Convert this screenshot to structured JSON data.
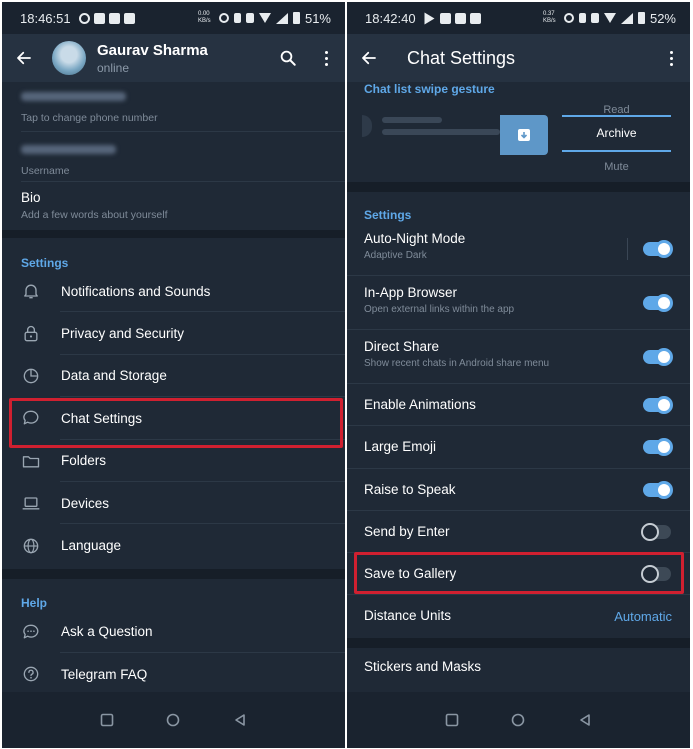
{
  "left": {
    "status": {
      "time": "18:46:51",
      "net": "0.00 KB/s",
      "battery": "51%"
    },
    "profile": {
      "name": "Gaurav Sharma",
      "status": "online"
    },
    "account": [
      {
        "hint": "Tap to change phone number"
      },
      {
        "hint": "Username"
      },
      {
        "label": "Bio",
        "hint": "Add a few words about yourself"
      }
    ],
    "settings_header": "Settings",
    "settings_items": [
      {
        "label": "Notifications and Sounds",
        "icon": "bell-icon"
      },
      {
        "label": "Privacy and Security",
        "icon": "lock-icon"
      },
      {
        "label": "Data and Storage",
        "icon": "pie-chart-icon"
      },
      {
        "label": "Chat Settings",
        "icon": "chat-bubble-icon"
      },
      {
        "label": "Folders",
        "icon": "folder-icon"
      },
      {
        "label": "Devices",
        "icon": "laptop-icon"
      },
      {
        "label": "Language",
        "icon": "globe-icon"
      }
    ],
    "help_header": "Help",
    "help_items": [
      {
        "label": "Ask a Question",
        "icon": "chat-dots-icon"
      },
      {
        "label": "Telegram FAQ",
        "icon": "question-icon"
      }
    ]
  },
  "right": {
    "status": {
      "time": "18:42:40",
      "net": "0.37 KB/s",
      "battery": "52%"
    },
    "title": "Chat Settings",
    "swipe": {
      "title": "Chat list swipe gesture",
      "options": [
        "Read",
        "Archive",
        "Mute"
      ],
      "selected": "Archive"
    },
    "settings_header": "Settings",
    "rows": [
      {
        "label": "Auto-Night Mode",
        "sub": "Adaptive Dark",
        "toggle": true
      },
      {
        "label": "In-App Browser",
        "sub": "Open external links within the app",
        "toggle": true
      },
      {
        "label": "Direct Share",
        "sub": "Show recent chats in Android share menu",
        "toggle": true
      },
      {
        "label": "Enable Animations",
        "toggle": true
      },
      {
        "label": "Large Emoji",
        "toggle": true
      },
      {
        "label": "Raise to Speak",
        "toggle": true
      },
      {
        "label": "Send by Enter",
        "toggle": false
      },
      {
        "label": "Save to Gallery",
        "toggle": false
      },
      {
        "label": "Distance Units",
        "value": "Automatic"
      }
    ],
    "stickers": "Stickers and Masks"
  },
  "colors": {
    "accent": "#5fa8e8",
    "highlight": "#d02030",
    "background": "#1f2936"
  }
}
